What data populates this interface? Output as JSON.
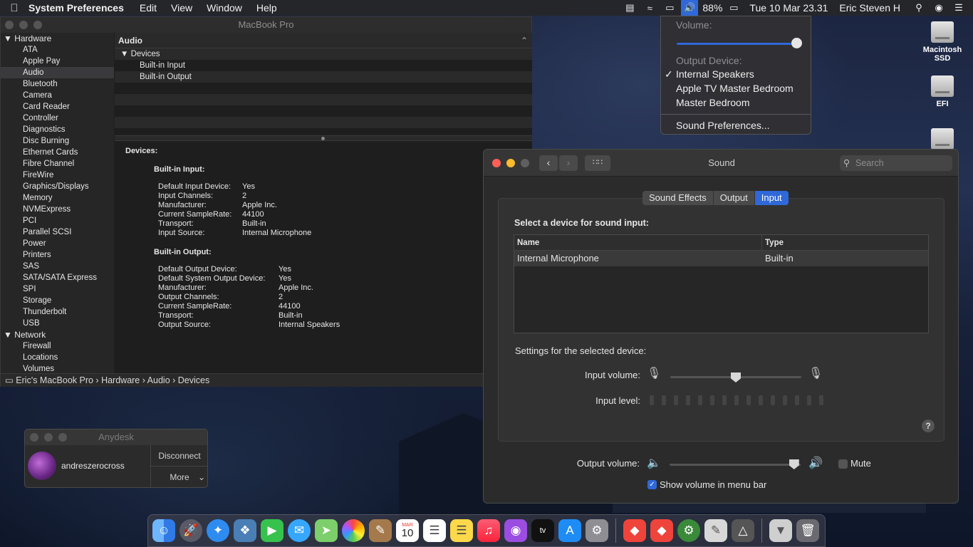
{
  "menubar": {
    "app_name": "System Preferences",
    "menus": [
      "Edit",
      "View",
      "Window",
      "Help"
    ],
    "battery": "88%",
    "datetime": "Tue 10 Mar  23.31",
    "user": "Eric Steven H"
  },
  "volume_menu": {
    "volume_header": "Volume:",
    "volume_level": 0.95,
    "output_header": "Output Device:",
    "devices": [
      "Internal Speakers",
      "Apple TV Master Bedroom",
      "Master Bedroom"
    ],
    "selected_device": "Internal Speakers",
    "sound_prefs": "Sound Preferences..."
  },
  "sysinfo": {
    "window_title": "MacBook Pro",
    "sidebar": {
      "hardware_label": "Hardware",
      "hardware_items": [
        "ATA",
        "Apple Pay",
        "Audio",
        "Bluetooth",
        "Camera",
        "Card Reader",
        "Controller",
        "Diagnostics",
        "Disc Burning",
        "Ethernet Cards",
        "Fibre Channel",
        "FireWire",
        "Graphics/Displays",
        "Memory",
        "NVMExpress",
        "PCI",
        "Parallel SCSI",
        "Power",
        "Printers",
        "SAS",
        "SATA/SATA Express",
        "SPI",
        "Storage",
        "Thunderbolt",
        "USB"
      ],
      "selected": "Audio",
      "network_label": "Network",
      "network_items": [
        "Firewall",
        "Locations",
        "Volumes"
      ]
    },
    "header": "Audio",
    "tree": {
      "devices": "Devices",
      "input": "Built-in Input",
      "output": "Built-in Output"
    },
    "detail": {
      "devices_label": "Devices:",
      "input_label": "Built-in Input:",
      "input_kv": [
        [
          "Default Input Device:",
          "Yes"
        ],
        [
          "Input Channels:",
          "2"
        ],
        [
          "Manufacturer:",
          "Apple Inc."
        ],
        [
          "Current SampleRate:",
          "44100"
        ],
        [
          "Transport:",
          "Built-in"
        ],
        [
          "Input Source:",
          "Internal Microphone"
        ]
      ],
      "output_label": "Built-in Output:",
      "output_kv": [
        [
          "Default Output Device:",
          "Yes"
        ],
        [
          "Default System Output Device:",
          "Yes"
        ],
        [
          "Manufacturer:",
          "Apple Inc."
        ],
        [
          "Output Channels:",
          "2"
        ],
        [
          "Current SampleRate:",
          "44100"
        ],
        [
          "Transport:",
          "Built-in"
        ],
        [
          "Output Source:",
          "Internal Speakers"
        ]
      ]
    },
    "path": "Eric's MacBook Pro › Hardware › Audio › Devices"
  },
  "sound": {
    "title": "Sound",
    "search_placeholder": "Search",
    "tabs": [
      "Sound Effects",
      "Output",
      "Input"
    ],
    "active_tab": "Input",
    "select_label": "Select a device for sound input:",
    "col_name": "Name",
    "col_type": "Type",
    "device_name": "Internal Microphone",
    "device_type": "Built-in",
    "settings_label": "Settings for the selected device:",
    "input_volume_label": "Input volume:",
    "input_volume": 0.5,
    "input_level_label": "Input level:",
    "output_volume_label": "Output volume:",
    "output_volume": 0.95,
    "mute_label": "Mute",
    "mute": false,
    "show_volume_label": "Show volume in menu bar",
    "show_volume": true,
    "help": "?"
  },
  "anydesk": {
    "title": "Anydesk",
    "user": "andreszerocross",
    "disconnect": "Disconnect",
    "more": "More"
  },
  "desktop": {
    "icons": [
      "Macintosh SSD",
      "EFI"
    ]
  },
  "dock": {
    "calendar_month": "MAR",
    "calendar_day": "10"
  },
  "colors": {
    "accent": "#2f68d8",
    "close": "#ff5f57",
    "minimize": "#febc2e",
    "maximize": "#5f5f5f"
  }
}
